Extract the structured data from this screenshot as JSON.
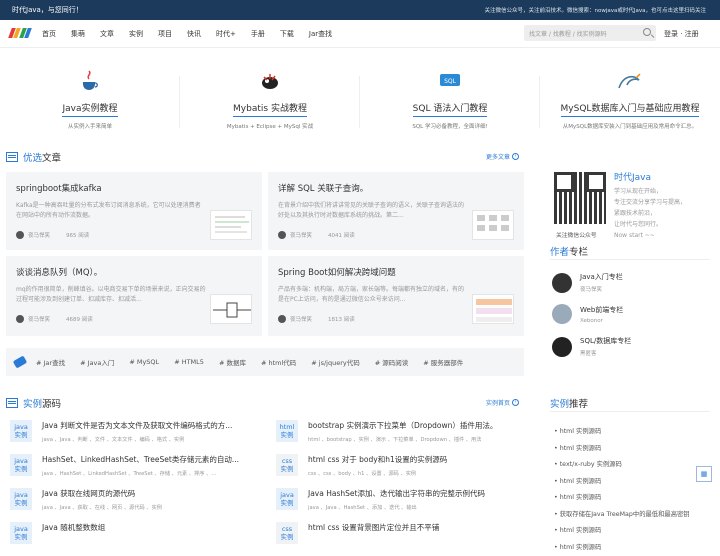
{
  "topbar": {
    "left": "时代Java，与您同行！",
    "right": "关注微信公众号，关注前沿技术。微信搜索：nowjava或时代Java，也可点击这里扫码关注"
  },
  "nav": {
    "items": [
      "首页",
      "集萌",
      "文章",
      "实例",
      "项目",
      "快讯",
      "时代+",
      "手册",
      "下载",
      "Jar查找"
    ],
    "search_placeholder": "找文章 / 找教程 / 找实例源码",
    "login": "登录 · 注册"
  },
  "features": [
    {
      "title": "Java实例教程",
      "desc": "从实例入手来简单",
      "icon": "java-cup-icon"
    },
    {
      "title": "Mybatis 实战教程",
      "desc": "Mybatis + Eclipse + MySql 实战",
      "icon": "mybatis-bird-icon"
    },
    {
      "title": "SQL 语法入门教程",
      "desc": "SQL 学习必备教程，全面详细!",
      "icon": "sql-icon"
    },
    {
      "title": "MySQL数据库入门与基础应用教程",
      "desc": "从MySQL数据库安装入门到基础应用及常用命令汇总。",
      "icon": "mysql-dolphin-icon"
    }
  ],
  "articles": {
    "heading_accent": "优选",
    "heading_rest": "文章",
    "more": "更多文章",
    "items": [
      {
        "title": "springboot集成kafka",
        "desc": "Kafka是一种高吞吐量的分布式发布订阅消息系统，它可以处理消费者在网站中的所有动作流数据。",
        "author": "夜马悍笑",
        "views": "965 阅读"
      },
      {
        "title": "详解 SQL 关联子查询。",
        "desc": "在背景介绍中我们将讲讲常见的关联子查询的语义，关联子查询语法的好处以及其执行时对数据库系统的挑战。第二...",
        "author": "夜马悍笑",
        "views": "4041 阅读"
      },
      {
        "title": "谈谈消息队列（MQ）。",
        "desc": "mq的作用很简单，削峰填谷。以电商交易下单的场景来说，正向交易的过程可能涉及到创建订单、扣减库存、扣减活...",
        "author": "夜马悍笑",
        "views": "4689 阅读"
      },
      {
        "title": "Spring Boot如何解决跨域问题",
        "desc": "产品有多端：机构端，局方端，家长端等。每端都有独立的域名，有的是在PC上访问，有的是通过微信公众号来访问...",
        "author": "夜马悍笑",
        "views": "1813 阅读"
      }
    ]
  },
  "tags": [
    "# Jar查找",
    "# Java入门",
    "# MySQL",
    "# HTML5",
    "# 数据库",
    "# html代码",
    "# js/jquery代码",
    "# 源码阅读",
    "# 服务器部件"
  ],
  "source": {
    "heading_accent": "实例",
    "heading_rest": "源码",
    "more": "实例首页",
    "items": [
      {
        "lang": "java",
        "title": "Java 判断文件是否为文本文件及获取文件编码格式的方...",
        "tags": "java 、Java 、判断 、文件 、文本文件 、编码 、格式 、实例"
      },
      {
        "lang": "html",
        "title": "bootstrap 实例演示下拉菜单（Dropdown）插件用法。",
        "tags": "html 、bootstrap 、实例 、演示 、下拉菜单 、Dropdown 、插件 、用法"
      },
      {
        "lang": "java",
        "title": "HashSet、LinkedHashSet、TreeSet类存储元素的自动...",
        "tags": "java 、HashSet 、LinkedHashSet 、TreeSet 、存储 、元素 、排序 、..."
      },
      {
        "lang": "css",
        "title": "html css 对于 body和h1设置的实例源码",
        "tags": "css 、css 、body 、h1 、设置 、源码 、实例"
      },
      {
        "lang": "java",
        "title": "Java 获取在线网页的源代码",
        "tags": "java 、Java 、获取 、在线 、网页 、源代码 、实例"
      },
      {
        "lang": "java",
        "title": "Java HashSet添加、迭代输出字符串的完整示例代码",
        "tags": "java 、Java 、HashSet 、添加 、迭代 、输出"
      },
      {
        "lang": "java",
        "title": "Java 随机整数数组",
        "tags": ""
      },
      {
        "lang": "css",
        "title": "html css 设置背景图片定位并且不平铺",
        "tags": ""
      }
    ]
  },
  "sidebar": {
    "brand": "时代Java",
    "brand_lines": [
      "学习从现在开始，",
      "专注交流分享学习与提高，",
      "紧跟技术前沿，",
      "让时代与您同行。",
      "Now start ~~"
    ],
    "qr_caption": "关注微信公众号",
    "authors_heading_accent": "作者",
    "authors_heading_rest": "专栏",
    "authors": [
      {
        "name": "Java入门专栏",
        "sub": "夜马悍笑"
      },
      {
        "name": "Web前端专栏",
        "sub": "Xebonor"
      },
      {
        "name": "SQL/数据库专栏",
        "sub": "黑匿客"
      }
    ],
    "rec_heading_accent": "实例",
    "rec_heading_rest": "推荐",
    "recs": [
      "• html 实例源码",
      "• html 实例源码",
      "• text/x-ruby 实例源码",
      "• html 实例源码",
      "• html 实例源码",
      "• 获取存储在Java TreeMap中的最低和最高密钥",
      "• html 实例源码",
      "• html 实例源码"
    ]
  },
  "colors": {
    "accent": "#2b7bd6",
    "topbar": "#1b3a5c"
  }
}
